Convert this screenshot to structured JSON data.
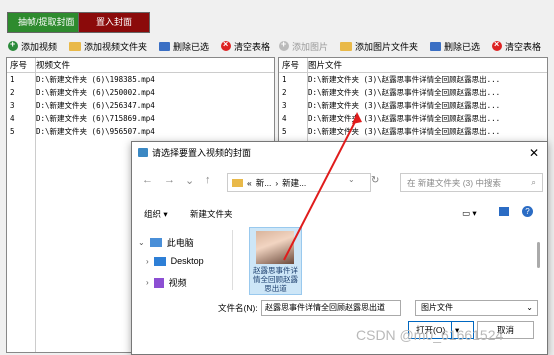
{
  "top_tabs": [
    "抽帧/提取封面",
    "置入封面"
  ],
  "toolbar": [
    {
      "label": "添加视频",
      "icon": "add-circle-icon"
    },
    {
      "label": "添加视频文件夹",
      "icon": "folder-icon"
    },
    {
      "label": "删除已选",
      "icon": "delete-icon"
    },
    {
      "label": "清空表格",
      "icon": "clear-icon"
    },
    {
      "label": "添加图片",
      "icon": "add-circle-icon",
      "disabled": true
    },
    {
      "label": "添加图片文件夹",
      "icon": "folder-icon"
    },
    {
      "label": "删除已选",
      "icon": "delete-icon"
    },
    {
      "label": "清空表格",
      "icon": "clear-icon"
    }
  ],
  "left_table": {
    "headers": [
      "序号",
      "视频文件"
    ],
    "rows": [
      [
        "1",
        "D:\\新建文件夹 (6)\\198385.mp4"
      ],
      [
        "2",
        "D:\\新建文件夹 (6)\\250002.mp4"
      ],
      [
        "3",
        "D:\\新建文件夹 (6)\\256347.mp4"
      ],
      [
        "4",
        "D:\\新建文件夹 (6)\\715869.mp4"
      ],
      [
        "5",
        "D:\\新建文件夹 (6)\\956507.mp4"
      ]
    ]
  },
  "right_table": {
    "headers": [
      "序号",
      "图片文件"
    ],
    "rows": [
      [
        "1",
        "D:\\新建文件夹 (3)\\赵露思事件详情全回顾赵露思出..."
      ],
      [
        "2",
        "D:\\新建文件夹 (3)\\赵露思事件详情全回顾赵露思出..."
      ],
      [
        "3",
        "D:\\新建文件夹 (3)\\赵露思事件详情全回顾赵露思出..."
      ],
      [
        "4",
        "D:\\新建文件夹 (3)\\赵露思事件详情全回顾赵露思出..."
      ],
      [
        "5",
        "D:\\新建文件夹 (3)\\赵露思事件详情全回顾赵露思出..."
      ]
    ]
  },
  "dialog": {
    "title": "请选择要置入视频的封面",
    "close": "✕",
    "address_parts": [
      "«",
      "新...",
      "›",
      "新建..."
    ],
    "search_placeholder": "在 新建文件夹 (3) 中搜索",
    "organize": "组织 ▾",
    "new_folder": "新建文件夹",
    "sidebar": [
      {
        "label": "此电脑",
        "icon": "computer-icon",
        "expanded": true
      },
      {
        "label": "Desktop",
        "icon": "desktop-icon"
      },
      {
        "label": "视频",
        "icon": "video-icon"
      }
    ],
    "file_label": "赵露思事件详情全回顾赵露思出道",
    "filename_label": "文件名(N):",
    "filename_value": "赵露思事件详情全回顾赵露思出道",
    "filter_value": "图片文件",
    "open_button": "打开(O)",
    "cancel_button": "取消"
  },
  "watermark": "CSDN @m0_61661524"
}
